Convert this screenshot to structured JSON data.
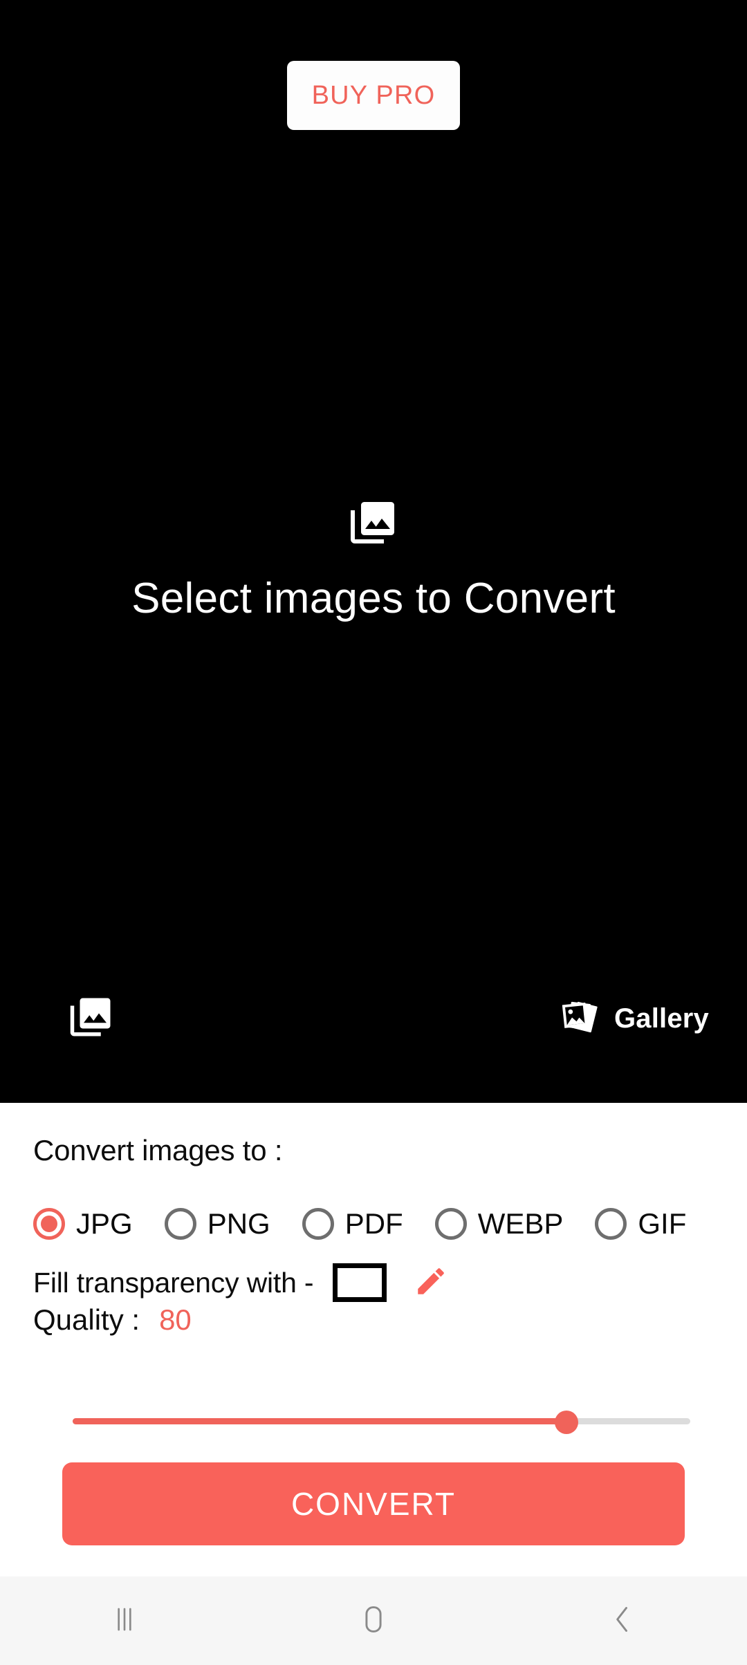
{
  "hero": {
    "buy_pro_label": "BUY PRO",
    "title": "Select images to Convert",
    "placeholder_icon": "photo-library-icon",
    "library_icon": "photo-library-icon",
    "gallery_icon": "stacked-photos-icon",
    "gallery_label": "Gallery",
    "background_color": "#000000"
  },
  "settings": {
    "heading": "Convert images to :",
    "formats": [
      {
        "label": "JPG",
        "selected": true
      },
      {
        "label": "PNG",
        "selected": false
      },
      {
        "label": "PDF",
        "selected": false
      },
      {
        "label": "WEBP",
        "selected": false
      },
      {
        "label": "GIF",
        "selected": false
      }
    ],
    "transparency": {
      "label": "Fill transparency with -",
      "swatch_color": "#FFFFFF",
      "swatch_border": "#000000",
      "edit_icon": "pencil-icon"
    },
    "quality": {
      "label": "Quality :",
      "value": "80",
      "slider_percent": 80,
      "min": 0,
      "max": 100
    },
    "convert_label": "CONVERT",
    "accent_color": "#F0635A"
  },
  "navbar": {
    "recents_icon": "recents-icon",
    "home_icon": "home-icon",
    "back_icon": "back-icon",
    "background_color": "#F6F6F6",
    "icon_color": "#8A8A8A"
  }
}
